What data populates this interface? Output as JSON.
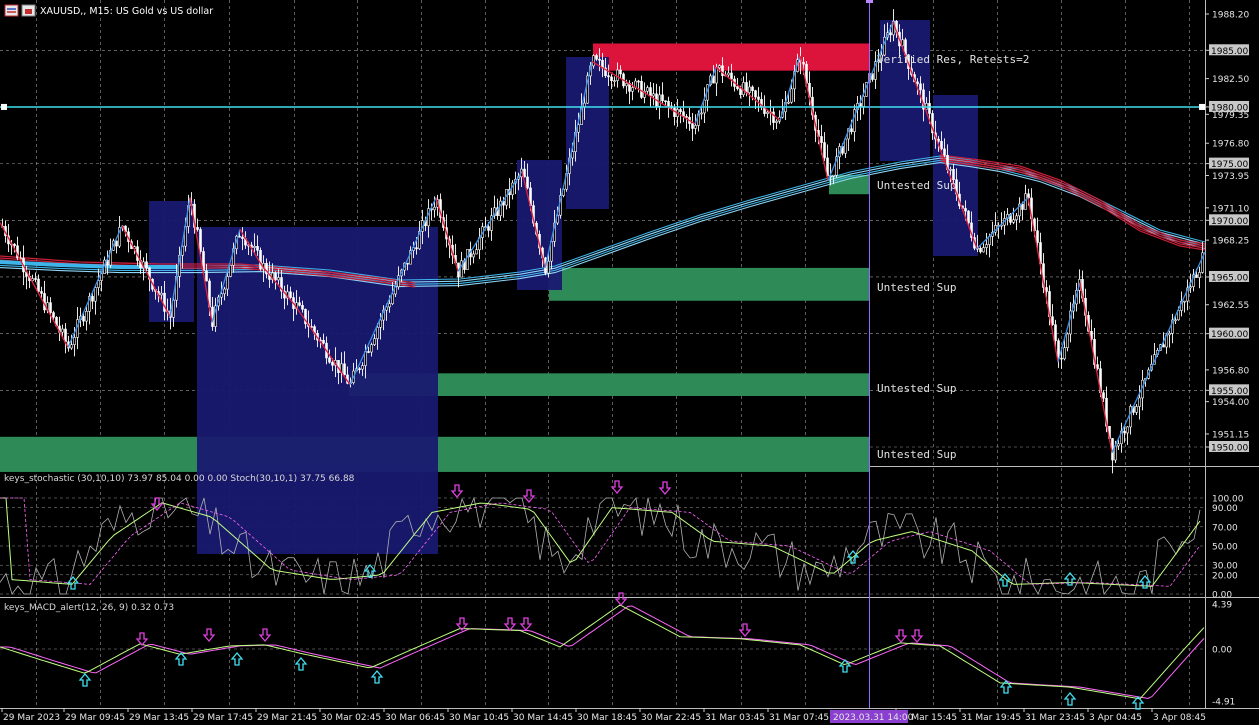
{
  "window": {
    "title": "XAUUSD,, M15: US Gold vs US dollar",
    "icons": [
      "chart-icon",
      "gold-icon"
    ]
  },
  "colors": {
    "background": "#000000",
    "grid": "#9a9a9a",
    "bull_swing": "#3d8fe6",
    "bear_swing": "#e0203c",
    "resistance_zone": "#dc143c",
    "support_zone": "#2e8b57",
    "box": "#191970",
    "horizontal_line": "#40e0f0",
    "ema_up": "#3db5ea",
    "ema_down": "#c8203a",
    "stoch_main": "#b0b0b0",
    "stoch_signal": "#c0ff80",
    "macd_main": "#c0ff80",
    "macd_signal": "#ff66ff",
    "buy_arrow": "#40e0f0",
    "sell_arrow": "#e040e0",
    "crosshair": "#9966ff"
  },
  "main_chart": {
    "y_ticks": [
      "1988.20",
      "1985.00",
      "1982.50",
      "1980.00",
      "1979.35",
      "1976.80",
      "1975.00",
      "1973.95",
      "1971.10",
      "1970.00",
      "1968.25",
      "1965.00",
      "1962.55",
      "1960.00",
      "1956.80",
      "1955.00",
      "1954.00",
      "1951.15",
      "1950.00"
    ],
    "highlighted_levels": [
      "1985.00",
      "1980.00",
      "1975.00",
      "1970.00",
      "1965.00",
      "1960.00",
      "1955.00",
      "1950.00"
    ],
    "zone_labels": {
      "res": "Verified Res, Retests=2",
      "sup1": "Untested Sup",
      "sup2": "Untested Sup",
      "sup3": "Untested Sup",
      "sup4": "Untested Sup"
    }
  },
  "stoch_panel": {
    "label": "keys_stochastic (30,10,10) 73.97 85.04 0.00 0.00 Stoch(30,10,1) 37.75 66.88",
    "y_ticks": [
      "100.00",
      "90.00",
      "70.00",
      "50.00",
      "30.00",
      "20.00",
      "0.00"
    ]
  },
  "macd_panel": {
    "label": "keys_MACD_alert(12, 26, 9) 0.32 0.73",
    "y_ticks": [
      "4.39",
      "0.00",
      "-4.91"
    ]
  },
  "x_axis": {
    "labels": [
      "29 Mar 2023",
      "29 Mar 09:45",
      "29 Mar 13:45",
      "29 Mar 17:45",
      "29 Mar 21:45",
      "30 Mar 02:45",
      "30 Mar 06:45",
      "30 Mar 10:45",
      "30 Mar 14:45",
      "30 Mar 18:45",
      "30 Mar 22:45",
      "31 Mar 03:45",
      "31 Mar 07:45",
      "31 Mar 15:45",
      "31 Mar 19:45",
      "31 Mar 23:45",
      "3 Apr 04:45",
      "3 Apr 08:45"
    ],
    "crosshair_label": "2023.03.31 14:00"
  },
  "chart_data": {
    "type": "candlestick",
    "title": "XAUUSD,, M15: US Gold vs US dollar",
    "y_range": [
      1948.9,
      1989.4
    ],
    "swing_points": [
      [
        0,
        1969.8
      ],
      [
        68,
        1958.8
      ],
      [
        122,
        1969.5
      ],
      [
        170,
        1961.5
      ],
      [
        190,
        1972.0
      ],
      [
        212,
        1961.0
      ],
      [
        240,
        1969.2
      ],
      [
        262,
        1966.0
      ],
      [
        295,
        1962.5
      ],
      [
        350,
        1955.5
      ],
      [
        436,
        1972.0
      ],
      [
        458,
        1965.5
      ],
      [
        522,
        1974.3
      ],
      [
        545,
        1965.8
      ],
      [
        592,
        1984.0
      ],
      [
        640,
        1981.5
      ],
      [
        695,
        1978.5
      ],
      [
        716,
        1983.5
      ],
      [
        780,
        1978.8
      ],
      [
        800,
        1984.5
      ],
      [
        828,
        1973.5
      ],
      [
        893,
        1987.5
      ],
      [
        977,
        1967.5
      ],
      [
        1028,
        1972.0
      ],
      [
        1058,
        1957.5
      ],
      [
        1080,
        1964.5
      ],
      [
        1112,
        1949.5
      ],
      [
        1205,
        1967.2
      ]
    ],
    "resistance_zone": [
      1983.2,
      1985.6
    ],
    "support_zones": [
      [
        1974.0,
        1972.3
      ],
      [
        1965.8,
        1962.9
      ],
      [
        1956.5,
        1954.5
      ],
      [
        1950.9,
        1947.8
      ]
    ],
    "horizontal_line": 1980.0,
    "stoch_range": [
      0,
      100
    ],
    "macd_range": [
      -4.91,
      4.39
    ]
  }
}
